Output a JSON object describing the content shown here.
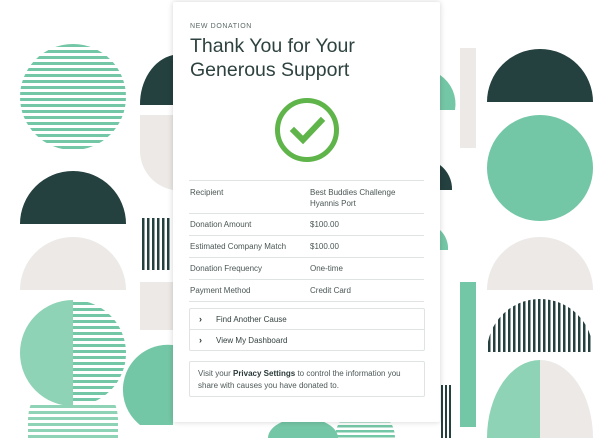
{
  "colors": {
    "dark_teal": "#24403f",
    "mint": "#74c7a6",
    "light_gray": "#ece9e7",
    "white_bg": "#ffffff",
    "check_green": "#5fb44a"
  },
  "donation": {
    "eyebrow": "NEW DONATION",
    "title": "Thank You for Your Generous Support",
    "status_icon": "checkmark-circle-icon"
  },
  "details": [
    {
      "label": "Recipient",
      "value": "Best Buddies Challenge Hyannis Port"
    },
    {
      "label": "Donation Amount",
      "value": "$100.00"
    },
    {
      "label": "Estimated Company Match",
      "value": "$100.00"
    },
    {
      "label": "Donation Frequency",
      "value": "One-time"
    },
    {
      "label": "Payment Method",
      "value": "Credit Card"
    }
  ],
  "links": [
    {
      "label": "Find Another Cause",
      "icon": "chevron-right-icon"
    },
    {
      "label": "View My Dashboard",
      "icon": "chevron-right-icon"
    }
  ],
  "privacy_note": {
    "before": "Visit your ",
    "link": "Privacy Settings",
    "after": " to control the information you share with causes you have donated to."
  }
}
